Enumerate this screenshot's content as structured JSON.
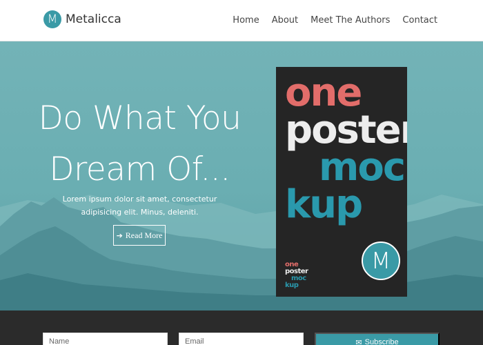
{
  "brand": {
    "logo_letter": "M",
    "name": "Metalicca"
  },
  "nav": {
    "items": [
      "Home",
      "About",
      "Meet The Authors",
      "Contact"
    ]
  },
  "hero": {
    "headline_line1": "Do What You",
    "headline_line2": "Dream Of...",
    "subtext": "Lorem ipsum dolor sit amet, consectetur adipisicing elit. Minus, deleniti.",
    "read_more_label": "Read More",
    "read_more_icon": "arrow-right-icon"
  },
  "poster": {
    "words": [
      "one",
      "poster",
      "moc",
      "kup"
    ],
    "mini_words": [
      "one",
      "poster",
      "moc",
      "kup"
    ],
    "badge_letter": "M"
  },
  "subscribe": {
    "name_placeholder": "Name",
    "email_placeholder": "Email",
    "button_label": "Subscribe",
    "button_icon": "envelope-icon"
  },
  "colors": {
    "accent": "#3a9aa6",
    "hero_bg": "#6aaeb2",
    "poster_bg": "#252525",
    "poster_red": "#e26d6a",
    "poster_teal": "#2a99ad",
    "footer_bg": "#2b2b2b"
  }
}
